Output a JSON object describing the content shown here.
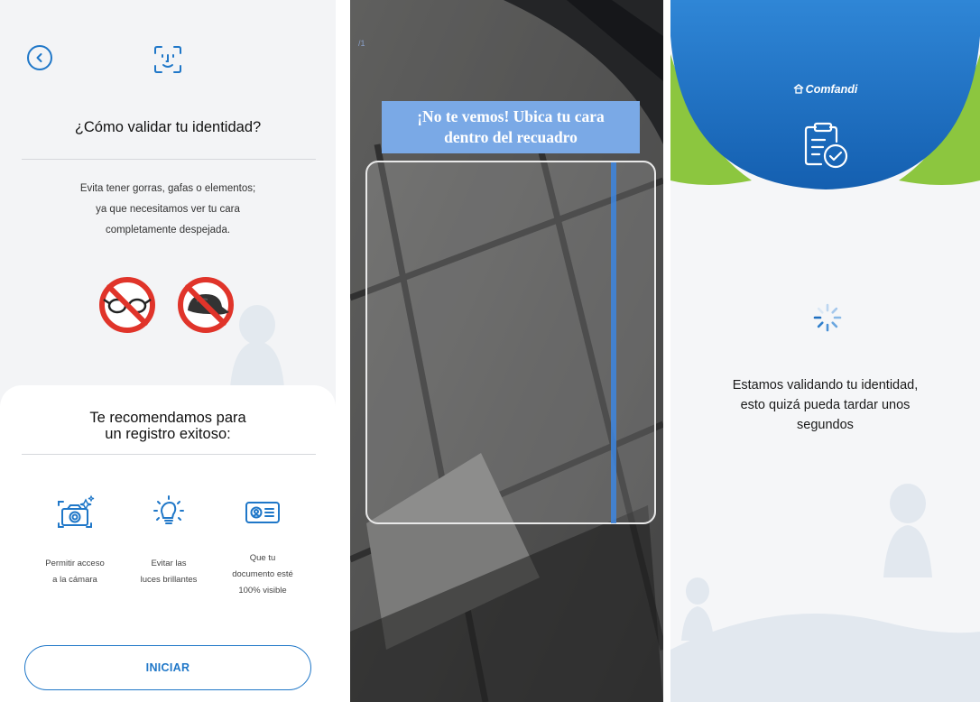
{
  "screen_intro": {
    "title": "¿Cómo validar tu identidad?",
    "body_lines": [
      "Evita tener gorras, gafas o elementos;",
      "ya que necesitamos ver tu cara",
      "completamente despejada."
    ],
    "rec_title_lines": [
      "Te recomendamos para",
      "un registro exitoso:"
    ],
    "recommendations": [
      {
        "icon": "camera-icon",
        "lines": [
          "Permitir acceso",
          "a la cámara"
        ]
      },
      {
        "icon": "bright-light-icon",
        "lines": [
          "Evitar las",
          "luces brillantes"
        ]
      },
      {
        "icon": "id-card-icon",
        "lines": [
          "Que tu",
          "documento esté",
          "100% visible"
        ]
      }
    ],
    "start_button": "INICIAR",
    "colors": {
      "accent": "#1f77c8",
      "ban_red": "#e0342a"
    }
  },
  "screen_camera": {
    "corner_tag": "/1",
    "message_lines": [
      "¡No te vemos! Ubica tu cara",
      "dentro del recuadro"
    ],
    "colors": {
      "banner": "#7aa9e6",
      "scan_line": "#3d86e0"
    }
  },
  "screen_loading": {
    "brand": "Comfandi",
    "message_lines": [
      "Estamos validando tu identidad,",
      "esto quizá pueda tardar unos",
      "segundos"
    ],
    "colors": {
      "header_blue": "#1a6fc2",
      "header_green": "#8cc63f"
    }
  }
}
